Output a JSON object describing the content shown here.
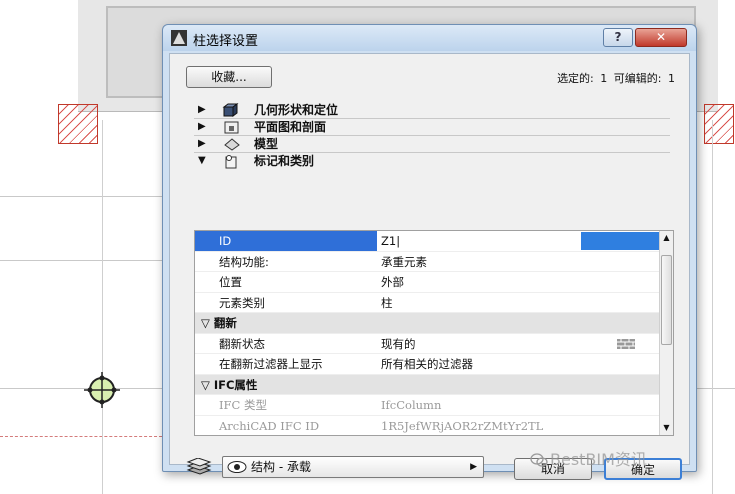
{
  "dialog": {
    "title": "柱选择设置",
    "help_label": "?",
    "close_label": "✕",
    "favorites_label": "收藏...",
    "selection": {
      "selected_label": "选定的:",
      "selected_count": "1",
      "editable_label": "可编辑的:",
      "editable_count": "1"
    }
  },
  "sections": [
    {
      "label": "几何形状和定位",
      "icon": "cube-icon",
      "expanded": false
    },
    {
      "label": "平面图和剖面",
      "icon": "floor-plan-icon",
      "expanded": false
    },
    {
      "label": "模型",
      "icon": "model-icon",
      "expanded": false
    },
    {
      "label": "标记和类别",
      "icon": "tag-icon",
      "expanded": true
    }
  ],
  "grid": {
    "rows": [
      {
        "key": "ID",
        "value": "Z1|"
      },
      {
        "key": "结构功能:",
        "value": "承重元素"
      },
      {
        "key": "位置",
        "value": "外部"
      },
      {
        "key": "元素类别",
        "value": "柱"
      }
    ],
    "renovation_header": "翻新",
    "renovation_rows": [
      {
        "key": "翻新状态",
        "value": "现有的"
      },
      {
        "key": "在翻新过滤器上显示",
        "value": "所有相关的过滤器"
      }
    ],
    "ifc_header": "IFC属性",
    "ifc_rows": [
      {
        "key": "IFC 类型",
        "value": "IfcColumn"
      },
      {
        "key": "ArchiCAD IFC ID",
        "value": "1R5JefWRjAOR2rZMtYr2TL"
      }
    ]
  },
  "footer": {
    "layer_label": "结构 - 承载",
    "cancel_label": "取消",
    "ok_label": "确定"
  },
  "watermark": {
    "text": "BestBIM资讯"
  },
  "colors": {
    "selection": "#2f6fd8",
    "close": "#c0392b",
    "ok_border": "#3c7fd6"
  }
}
